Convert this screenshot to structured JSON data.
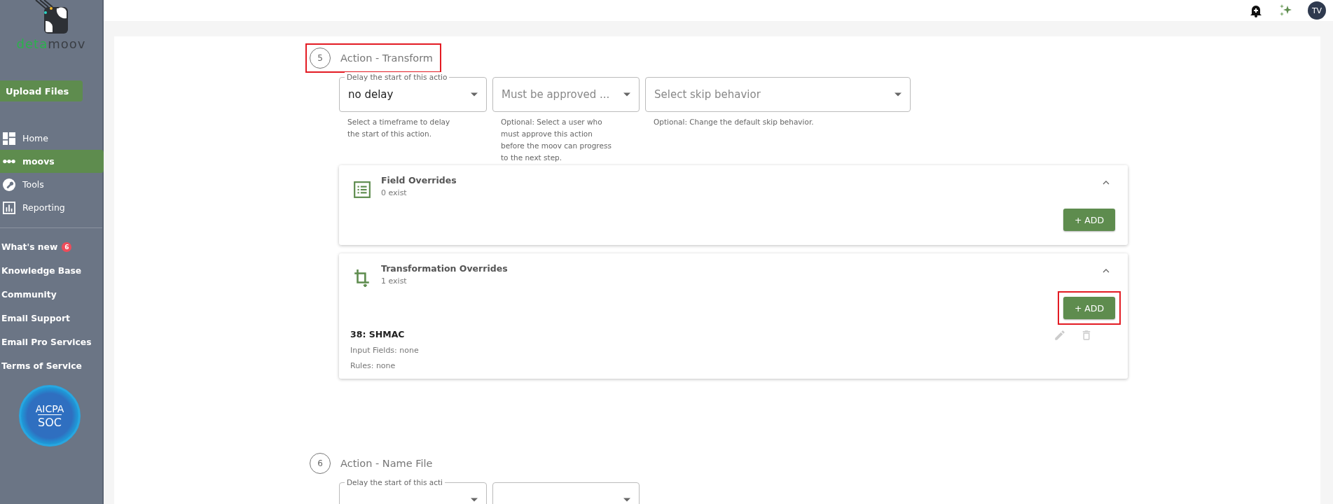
{
  "logo": {
    "accent": "deta",
    "rest": "moov"
  },
  "upload_button": "Upload Files",
  "nav": [
    {
      "label": "Home",
      "selected": false
    },
    {
      "label": "moovs",
      "selected": true
    },
    {
      "label": "Tools",
      "selected": false
    },
    {
      "label": "Reporting",
      "selected": false
    }
  ],
  "links": [
    {
      "label": "What's new",
      "badge": "6"
    },
    {
      "label": "Knowledge Base"
    },
    {
      "label": "Community"
    },
    {
      "label": "Email Support"
    },
    {
      "label": "Email Pro Services"
    },
    {
      "label": "Terms of Service"
    }
  ],
  "certification": {
    "line1": "AICPA",
    "line2": "SOC"
  },
  "topbar": {
    "avatar": "TV"
  },
  "steps": [
    {
      "number": "5",
      "title": "Action - Transform",
      "highlighted": true,
      "fields": [
        {
          "kind": "select",
          "label": "Delay the start of this actio",
          "value": "no delay",
          "helper": "Select a timeframe to delay the start of this action."
        },
        {
          "kind": "select",
          "placeholder": "Must be approved ...",
          "helper": "Optional: Select a user who must approve this action before the moov can progress to the next step."
        },
        {
          "kind": "select",
          "placeholder": "Select skip behavior",
          "helper": "Optional: Change the default skip behavior."
        }
      ],
      "panels": [
        {
          "title": "Field Overrides",
          "count": "0 exist",
          "expanded": true,
          "add_button": {
            "label": "+ ADD",
            "highlighted": false
          }
        },
        {
          "title": "Transformation Overrides",
          "count": "1 exist",
          "expanded": true,
          "add_button": {
            "label": "+ ADD",
            "highlighted": true
          },
          "items": [
            {
              "title": "38: SHMAC",
              "lines": [
                "Input Fields: none",
                "Rules: none"
              ]
            }
          ]
        }
      ]
    },
    {
      "number": "6",
      "title": "Action - Name File",
      "highlighted": false,
      "fields": [
        {
          "kind": "select",
          "label": "Delay the start of this acti"
        },
        {
          "kind": "select"
        }
      ]
    }
  ]
}
